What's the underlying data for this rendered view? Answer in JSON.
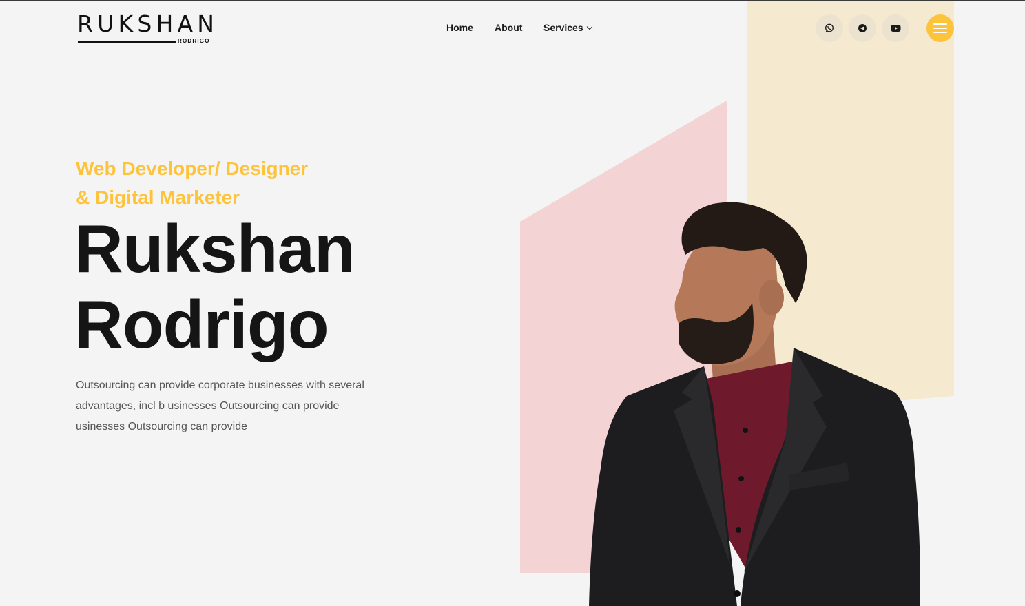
{
  "header": {
    "logo": {
      "word": "RUKSHAN",
      "sub": "RODRIGO"
    },
    "nav": [
      {
        "label": "Home"
      },
      {
        "label": "About"
      },
      {
        "label": "Services"
      }
    ],
    "social": [
      {
        "icon": "whatsapp-icon"
      },
      {
        "icon": "telegram-icon"
      },
      {
        "icon": "youtube-icon"
      }
    ],
    "menu_icon": "hamburger-menu-icon"
  },
  "hero": {
    "role_line1": "Web Developer/ Designer",
    "role_line2": "& Digital Marketer",
    "name_line1": "Rukshan",
    "name_line2": "Rodrigo",
    "description": "Outsourcing can provide corporate businesses with several advantages, incl b usinesses Outsourcing can provide usinesses Outsourcing can provide"
  },
  "colors": {
    "accent": "#fdc33b",
    "pink_shape": "#f4d3d4",
    "cream_shape": "#f5ead0",
    "background": "#f4f4f4",
    "text_dark": "#151515"
  }
}
